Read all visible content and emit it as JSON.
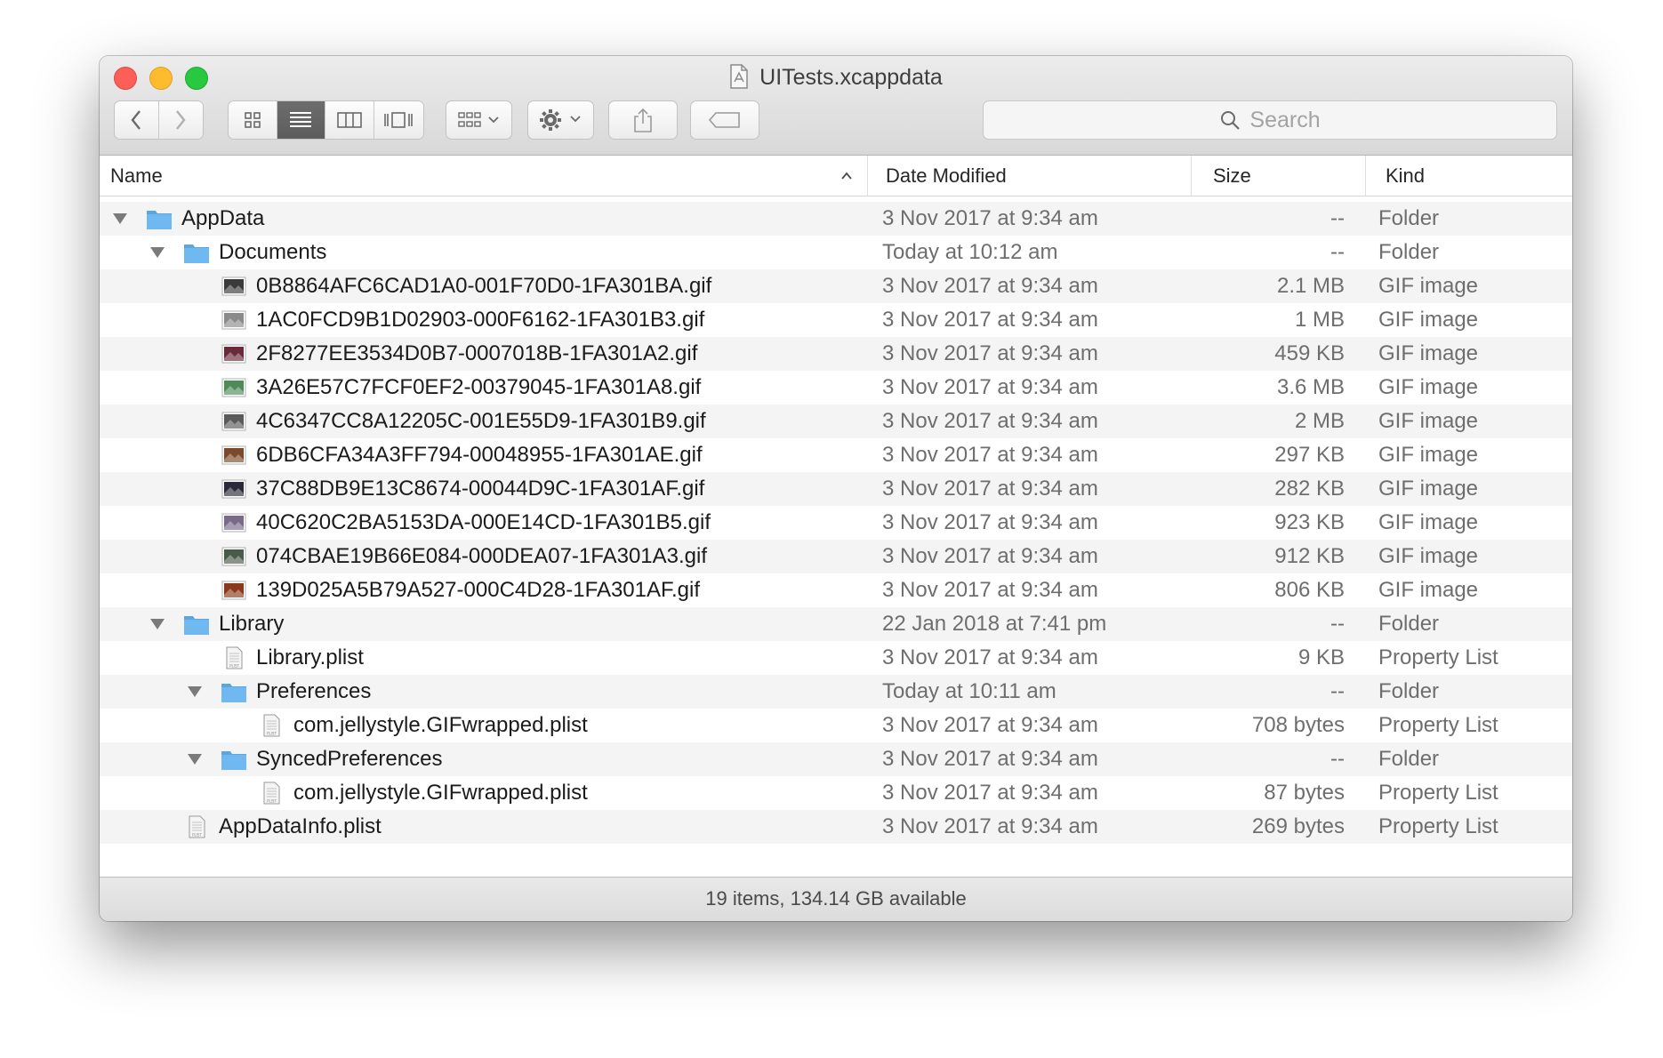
{
  "window": {
    "title": "UITests.xcappdata"
  },
  "toolbar": {
    "back": "chevron-left-icon",
    "forward": "chevron-right-icon",
    "view_modes": [
      "icon-view-icon",
      "list-view-icon",
      "column-view-icon",
      "coverflow-view-icon"
    ],
    "active_view": "list-view-icon",
    "group": "group-by-icon",
    "action": "gear-icon",
    "share": "share-icon",
    "tags": "tag-icon",
    "search_placeholder": "Search"
  },
  "columns": {
    "name": "Name",
    "date": "Date Modified",
    "size": "Size",
    "kind": "Kind"
  },
  "rows": [
    {
      "name": "AppData",
      "date": "3 Nov 2017 at 9:34 am",
      "size": "--",
      "kind": "Folder",
      "icon": "folder",
      "level": 0,
      "expanded": true
    },
    {
      "name": "Documents",
      "date": "Today at 10:12 am",
      "size": "--",
      "kind": "Folder",
      "icon": "folder",
      "level": 1,
      "expanded": true
    },
    {
      "name": "0B8864AFC6CAD1A0-001F70D0-1FA301BA.gif",
      "date": "3 Nov 2017 at 9:34 am",
      "size": "2.1 MB",
      "kind": "GIF image",
      "icon": "gif",
      "level": 2,
      "thumb": "#3a3a3a"
    },
    {
      "name": "1AC0FCD9B1D02903-000F6162-1FA301B3.gif",
      "date": "3 Nov 2017 at 9:34 am",
      "size": "1 MB",
      "kind": "GIF image",
      "icon": "gif",
      "level": 2,
      "thumb": "#8a8a8a"
    },
    {
      "name": "2F8277EE3534D0B7-0007018B-1FA301A2.gif",
      "date": "3 Nov 2017 at 9:34 am",
      "size": "459 KB",
      "kind": "GIF image",
      "icon": "gif",
      "level": 2,
      "thumb": "#6b2a3a"
    },
    {
      "name": "3A26E57C7FCF0EF2-00379045-1FA301A8.gif",
      "date": "3 Nov 2017 at 9:34 am",
      "size": "3.6 MB",
      "kind": "GIF image",
      "icon": "gif",
      "level": 2,
      "thumb": "#4f8a5a"
    },
    {
      "name": "4C6347CC8A12205C-001E55D9-1FA301B9.gif",
      "date": "3 Nov 2017 at 9:34 am",
      "size": "2 MB",
      "kind": "GIF image",
      "icon": "gif",
      "level": 2,
      "thumb": "#5a5a5a"
    },
    {
      "name": "6DB6CFA34A3FF794-00048955-1FA301AE.gif",
      "date": "3 Nov 2017 at 9:34 am",
      "size": "297 KB",
      "kind": "GIF image",
      "icon": "gif",
      "level": 2,
      "thumb": "#7a4a2a"
    },
    {
      "name": "37C88DB9E13C8674-00044D9C-1FA301AF.gif",
      "date": "3 Nov 2017 at 9:34 am",
      "size": "282 KB",
      "kind": "GIF image",
      "icon": "gif",
      "level": 2,
      "thumb": "#2a2a3a"
    },
    {
      "name": "40C620C2BA5153DA-000E14CD-1FA301B5.gif",
      "date": "3 Nov 2017 at 9:34 am",
      "size": "923 KB",
      "kind": "GIF image",
      "icon": "gif",
      "level": 2,
      "thumb": "#7a6a8a"
    },
    {
      "name": "074CBAE19B66E084-000DEA07-1FA301A3.gif",
      "date": "3 Nov 2017 at 9:34 am",
      "size": "912 KB",
      "kind": "GIF image",
      "icon": "gif",
      "level": 2,
      "thumb": "#4a5a4a"
    },
    {
      "name": "139D025A5B79A527-000C4D28-1FA301AF.gif",
      "date": "3 Nov 2017 at 9:34 am",
      "size": "806 KB",
      "kind": "GIF image",
      "icon": "gif",
      "level": 2,
      "thumb": "#8a3a1a"
    },
    {
      "name": "Library",
      "date": "22 Jan 2018 at 7:41 pm",
      "size": "--",
      "kind": "Folder",
      "icon": "folder",
      "level": 1,
      "expanded": true
    },
    {
      "name": "Library.plist",
      "date": "3 Nov 2017 at 9:34 am",
      "size": "9 KB",
      "kind": "Property List",
      "icon": "plist",
      "level": 2
    },
    {
      "name": "Preferences",
      "date": "Today at 10:11 am",
      "size": "--",
      "kind": "Folder",
      "icon": "folder",
      "level": 2,
      "expanded": true
    },
    {
      "name": "com.jellystyle.GIFwrapped.plist",
      "date": "3 Nov 2017 at 9:34 am",
      "size": "708 bytes",
      "kind": "Property List",
      "icon": "plist",
      "level": 3
    },
    {
      "name": "SyncedPreferences",
      "date": "3 Nov 2017 at 9:34 am",
      "size": "--",
      "kind": "Folder",
      "icon": "folder",
      "level": 2,
      "expanded": true
    },
    {
      "name": "com.jellystyle.GIFwrapped.plist",
      "date": "3 Nov 2017 at 9:34 am",
      "size": "87 bytes",
      "kind": "Property List",
      "icon": "plist",
      "level": 3
    },
    {
      "name": "AppDataInfo.plist",
      "date": "3 Nov 2017 at 9:34 am",
      "size": "269 bytes",
      "kind": "Property List",
      "icon": "plist",
      "level": 1
    }
  ],
  "plist_icon_label": "PLIST",
  "status": "19 items, 134.14 GB available",
  "colors": {
    "folder": "#6fb8f0",
    "folder_tab": "#5aa6e2",
    "close": "#fc5f57",
    "minimize": "#fdbc2e",
    "maximize": "#28c840"
  }
}
